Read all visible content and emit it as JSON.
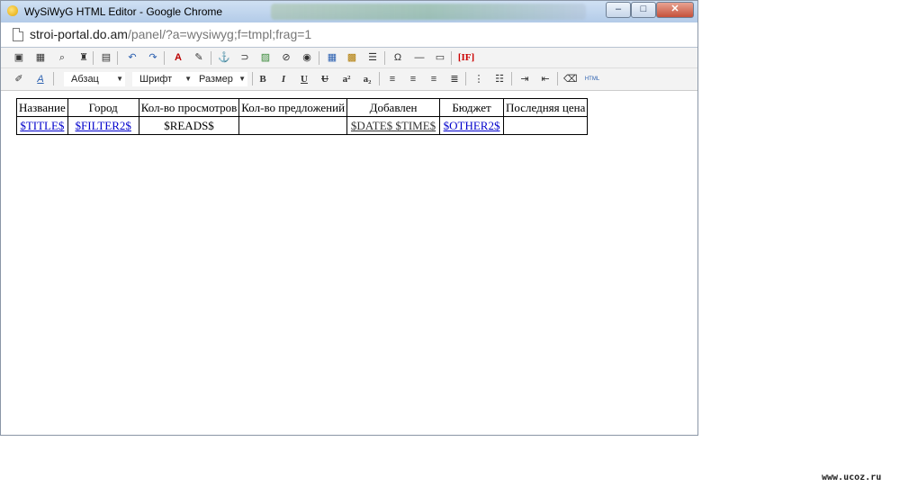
{
  "window": {
    "title": "WySiWyG HTML Editor - Google Chrome",
    "minimize_icon": "minimize-icon",
    "maximize_icon": "maximize-icon",
    "close_icon": "close-icon"
  },
  "address": {
    "host": "stroi-portal.do.am",
    "path": "/panel/?a=wysiwyg;f=tmpl;frag=1"
  },
  "toolbar1": {
    "icons": [
      "save-icon",
      "save-as-icon",
      "preview-icon",
      "find-icon",
      "paste-icon",
      "undo-icon",
      "redo-icon",
      "font-color-icon",
      "highlight-color-icon",
      "anchor-icon",
      "link-icon",
      "image-icon",
      "flash-icon",
      "media-icon",
      "table-icon",
      "table-edit-icon",
      "form-icon",
      "special-char-icon",
      "horizontal-rule-icon",
      "textfield-icon",
      "conditional-if-icon"
    ],
    "if_label": "[IF]"
  },
  "toolbar2": {
    "format_select": "Абзац",
    "font_select": "Шрифт",
    "size_select": "Размер",
    "bold": "B",
    "italic": "I",
    "underline": "U",
    "strike": "U",
    "superscript": "a²",
    "subscript": "a₂"
  },
  "table": {
    "headers": [
      "Название",
      "Город",
      "Кол-во просмотров",
      "Кол-во предложений",
      "Добавлен",
      "Бюджет",
      "Последняя цена"
    ],
    "row": [
      "$TITLE$",
      "$FILTER2$",
      "$READS$",
      "",
      "$DATE$ $TIME$",
      "$OTHER2$",
      ""
    ]
  },
  "watermark": "www.ucoz.ru"
}
